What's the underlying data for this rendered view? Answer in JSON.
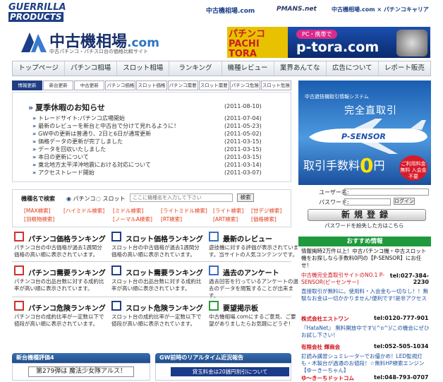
{
  "top": {
    "logo_line1": "GUERRILLA",
    "logo_line2": "PRODUCTS",
    "links": [
      "中古機相場.com",
      "PMANS.net",
      "中古機相場.com × パチンコキャリア"
    ]
  },
  "header": {
    "title": "中古機相場",
    "title_suffix": ".com",
    "subtitle": "中古パチンコ・パチスロ台の価格比較サイト"
  },
  "banner": {
    "left_text": "パチンコ PACHI TORA",
    "pc_text": "PC・携帯で",
    "url": "p-tora.com"
  },
  "nav": [
    "トップページ",
    "パチンコ相場",
    "スロット相場",
    "ランキング",
    "機種レビュー",
    "業界あんてな",
    "広告について",
    "レポート販売"
  ],
  "tabs": [
    "情報更新",
    "新台更新",
    "中古更新",
    "パチンコ価格",
    "スロット価格",
    "パチンコ需要",
    "スロット需要",
    "パチンコ危険",
    "スロット危険"
  ],
  "news": {
    "headline": "夏季休暇のお知らせ",
    "headline_date": "(2011-08-10)",
    "items": [
      {
        "text": "トレードサイト:パチンコ広場開始",
        "date": "(2011-07-04)"
      },
      {
        "text": "最新のレビューを新台と中古台で分けて見れるように！",
        "date": "(2011-05-23)"
      },
      {
        "text": "GW中の更新は普通り、2日と6日が通常更新",
        "date": "(2011-05-02)"
      },
      {
        "text": "価格データの更新が完了しました",
        "date": "(2011-03-15)"
      },
      {
        "text": "データを回収いたしました",
        "date": "(2011-03-15)"
      },
      {
        "text": "本日の更新について",
        "date": "(2011-03-15)"
      },
      {
        "text": "東北地方太平洋沖地震における対応について",
        "date": "(2011-03-14)"
      },
      {
        "text": "アクセストレード開始",
        "date": "(2011-03-07)"
      }
    ]
  },
  "promo": {
    "title": "中古遊技機取引情報システム",
    "big": "完全直取引",
    "plane": "P-SENSOR",
    "fee_prefix": "取引手数料",
    "fee_zero": "0",
    "fee_suffix": "円",
    "badge": "ご利用料金 無料 入会金不要"
  },
  "search": {
    "label": "機種名で検索",
    "radio1": "パチンコ",
    "radio2": "スロット",
    "placeholder": "ここに機種名を入力して下さい",
    "button": "検索",
    "tags_row1": [
      "[MAX検索]",
      "[ハイミドル検索]",
      "[ミドル検索]",
      "[ライトミドル検索]",
      "[ライト検索]",
      "[甘デジ検索]"
    ],
    "tags_row2": [
      "[羽根物検索]",
      "[ノーマルA検索]",
      "[RT検索]",
      "[ART検索]",
      "[価格検索]"
    ]
  },
  "login": {
    "user_label": "ユーザー名:",
    "pass_label": "パスワード:",
    "login_button": "ログイン",
    "register_button": "新規登録",
    "forgot": "パスワードを紛失した方はこちら"
  },
  "categories": [
    {
      "title": "パチンコ価格ランキング",
      "desc": "パチンコ台の中古価格が過去1週間分価格の高い順に表示されています。"
    },
    {
      "title": "スロット価格ランキング",
      "desc": "スロット台の中古価格が過去1週間分価格の高い順に表示されています。"
    },
    {
      "title": "最新のレビュー",
      "desc": "遊技機に対する評価が表示されています。当サイトの人気コンテンツです。"
    },
    {
      "title": "パチンコ需要ランキング",
      "desc": "パチンコ台の出品台数に対する成約比率が高い順に表示されています。"
    },
    {
      "title": "スロット需要ランキング",
      "desc": "スロット台の出品台数に対する成約比率が高い順に表示されています。"
    },
    {
      "title": "過去のアンケート",
      "desc": "過去回答を行っているアンケートの過去のデータを閲覧することが出来ます。"
    },
    {
      "title": "パチンコ危険ランキング",
      "desc": "パチンコ台の成約比率が一定数以下で値段が高い順に表示されています。"
    },
    {
      "title": "スロット危険ランキング",
      "desc": "スロット台の成約比率が一定数以下で値段が高い順に表示されています。"
    },
    {
      "title": "要望掲示板",
      "desc": "中古機相場.comにするご意見、ご要望がありましたらお気軽にどうぞ！"
    }
  ],
  "recommend": {
    "bar": "おすすめ情報",
    "p1": "情報掲時2万件以上！中古パチンコ機・中古スロット機をお探しなら手数料0円の【P-SENSOR】にお任せ！",
    "p2_name": "中古機完全直取引サイトのNO.1 P-SENSOR(ピーセンサー)",
    "p2_tel": "tel:027-384-2230",
    "p3": "直接取引が無料に。使用料・入会金も一切なし！！無駄なお金は一切かかりません!便利です!是非アクセス",
    "p4_name": "株式会社エストワン",
    "p4_tel": "tel:0120-777-901",
    "p5": "『HataNet』 無料開放中です\\(^o^)/この機会にぜひお試し下さい！",
    "p6_name": "有限会社 輝商会",
    "p6_tel": "tel:052-505-1034",
    "p7": "釘読み講習シュミレーターでお優かめ！LED監視灯も・木製台が過通のお値段！☆無料HP検索エンジン【ゆーきーちゃん】",
    "p8_name": "ゆ～きーちドットコム",
    "p8_tel": "tel:048-793-0707"
  },
  "bottom": {
    "sec1": "新台機種評価4",
    "vote": "第279弾は 魔法少女隊アルス！",
    "sec2": "GW前時のリアルタイム近況報告",
    "rt": "貸玉料金は20銭円割引について"
  }
}
